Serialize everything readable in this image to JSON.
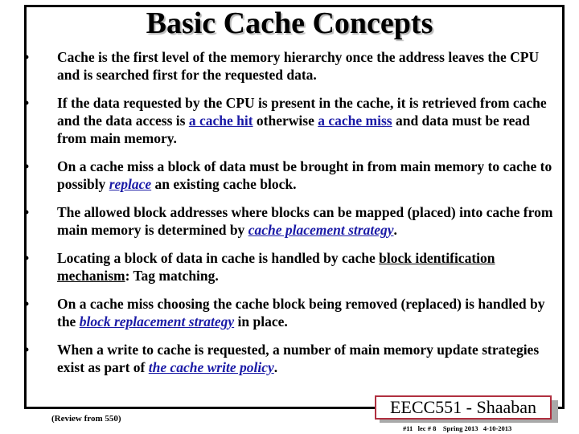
{
  "title": "Basic Cache Concepts",
  "bullet_glyph": "•",
  "bullets": [
    {
      "parts": [
        {
          "t": "Cache is the first level of the memory hierarchy once the address leaves the CPU and is searched first for the requested data."
        }
      ]
    },
    {
      "parts": [
        {
          "t": "If the data requested by the CPU is present in the cache, it is retrieved from cache  and the data access is "
        },
        {
          "t": "a cache hit",
          "link": true
        },
        {
          "t": " otherwise  "
        },
        {
          "t": "a cache miss",
          "link": true
        },
        {
          "t": " and data must be read from main memory."
        }
      ]
    },
    {
      "parts": [
        {
          "t": "On a cache miss a block of data must be brought in from main memory to cache to possibly "
        },
        {
          "t": "replace",
          "link": true,
          "italic": true
        },
        {
          "t": " an existing cache block."
        }
      ]
    },
    {
      "parts": [
        {
          "t": "The allowed block addresses where blocks can be mapped (placed) into cache from main memory is determined by "
        },
        {
          "t": "cache placement strategy",
          "link": true,
          "italic": true
        },
        {
          "t": "."
        }
      ]
    },
    {
      "parts": [
        {
          "t": "Locating a block of data in cache is handled by cache "
        },
        {
          "t": "block identification mechanism",
          "underline": true
        },
        {
          "t": ": Tag matching."
        }
      ]
    },
    {
      "parts": [
        {
          "t": "On a cache miss choosing the cache block being removed (replaced) is handled by the "
        },
        {
          "t": "block replacement strategy",
          "link": true,
          "italic": true
        },
        {
          "t": " in place."
        }
      ]
    },
    {
      "parts": [
        {
          "t": "When a write to cache is requested, a number of main memory update strategies exist as part of "
        },
        {
          "t": "the cache write policy",
          "link": true,
          "italic": true
        },
        {
          "t": "."
        }
      ]
    }
  ],
  "footer": {
    "review_note": "(Review from 550)",
    "badge": "EECC551 - Shaaban",
    "slide_info": "#11   lec # 8    Spring 2013   4-10-2013"
  },
  "colors": {
    "link": "#1a1aa6",
    "badge_border": "#b03040",
    "badge_shadow": "#a9a9a9"
  }
}
